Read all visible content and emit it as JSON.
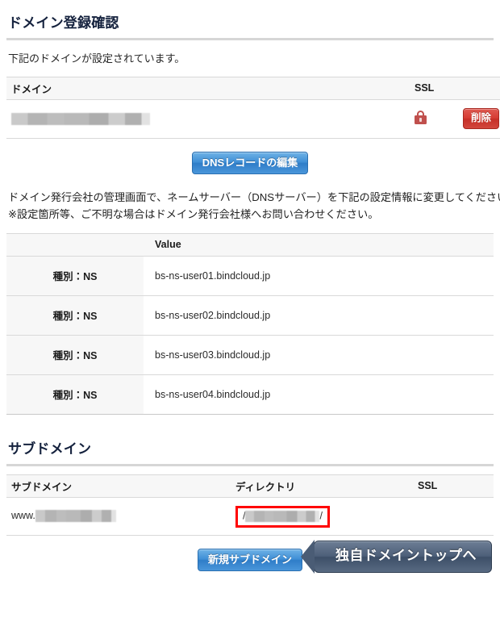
{
  "page": {
    "title": "ドメイン登録確認",
    "lead": "下記のドメインが設定されています。"
  },
  "domain_table": {
    "headers": {
      "domain": "ドメイン",
      "ssl": "SSL",
      "action": ""
    },
    "rows": [
      {
        "domain": "",
        "domain_redacted": true,
        "ssl_icon": "lock-icon",
        "delete_label": "削除"
      }
    ]
  },
  "dns_button": {
    "label": "DNSレコードの編集"
  },
  "notes": {
    "line1": "ドメイン発行会社の管理画面で、ネームサーバー（DNSサーバー）を下記の設定情報に変更してください。",
    "line2": "※設定箇所等、ご不明な場合はドメイン発行会社様へお問い合わせください。"
  },
  "ns_table": {
    "headers": {
      "type": "",
      "value": "Value"
    },
    "rows": [
      {
        "type": "種別：NS",
        "value": "bs-ns-user01.bindcloud.jp"
      },
      {
        "type": "種別：NS",
        "value": "bs-ns-user02.bindcloud.jp"
      },
      {
        "type": "種別：NS",
        "value": "bs-ns-user03.bindcloud.jp"
      },
      {
        "type": "種別：NS",
        "value": "bs-ns-user04.bindcloud.jp"
      }
    ]
  },
  "subdomain_section": {
    "title": "サブドメイン",
    "headers": {
      "subdomain": "サブドメイン",
      "directory": "ディレクトリ",
      "ssl": "SSL"
    },
    "rows": [
      {
        "subdomain_prefix": "www.",
        "subdomain_redacted": true,
        "dir_leading_slash": "/",
        "dir_trailing_slash": "/",
        "dir_redacted": true,
        "ssl": ""
      }
    ]
  },
  "footer": {
    "new_subdomain_label": "新規サブドメイン",
    "domain_top_label": "独自ドメイントップへ"
  },
  "colors": {
    "heading": "#14213d",
    "rule": "#d6d6d6",
    "blue_button": "#3f8fd6",
    "red_button": "#d63b32",
    "lock": "#c0504d",
    "annotation_box": "#ff0000",
    "arrow_button": "#4d5f79",
    "table_border": "#d9d9d9",
    "header_bg": "#f7f7f7"
  }
}
